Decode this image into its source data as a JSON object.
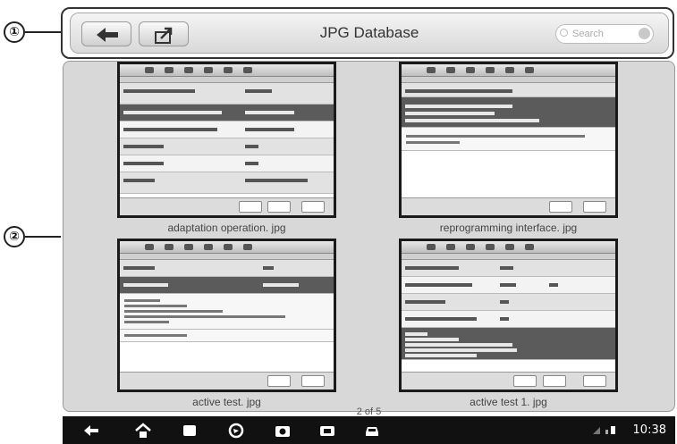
{
  "callouts": {
    "one": "①",
    "two": "②"
  },
  "topbar": {
    "back_icon": "back-arrow-icon",
    "share_icon": "share-export-icon",
    "title": "JPG Database",
    "search_placeholder": "Search"
  },
  "gallery": {
    "items": [
      {
        "caption": "adaptation operation. jpg"
      },
      {
        "caption": "reprogramming interface. jpg"
      },
      {
        "caption": "active test. jpg"
      },
      {
        "caption": "active test 1. jpg"
      }
    ],
    "pager": "2 of 5"
  },
  "statusbar": {
    "time": "10:38"
  },
  "colors": {
    "panel": "#d8d8d8",
    "navbar": "#111111",
    "thumb_border": "#1a1a1a"
  }
}
